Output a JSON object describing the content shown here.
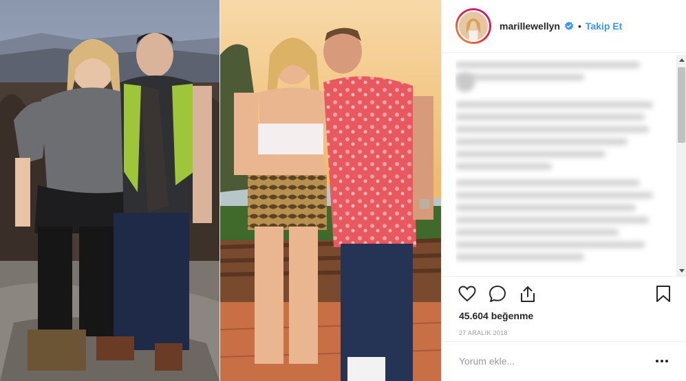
{
  "post": {
    "username": "marillewellyn",
    "separator": "•",
    "follow_label": "Takip Et",
    "likes_text": "45.604 beğenme",
    "date_text": "27 ARALIK 2018",
    "comment_placeholder": "Yorum ekle...",
    "verified_color": "#3897f0",
    "accent_color": "#3897f0"
  },
  "icons": {
    "like": "heart-icon",
    "comment": "comment-icon",
    "share": "share-icon",
    "save": "bookmark-icon",
    "options": "more-options-icon",
    "verified": "verified-badge-icon"
  }
}
